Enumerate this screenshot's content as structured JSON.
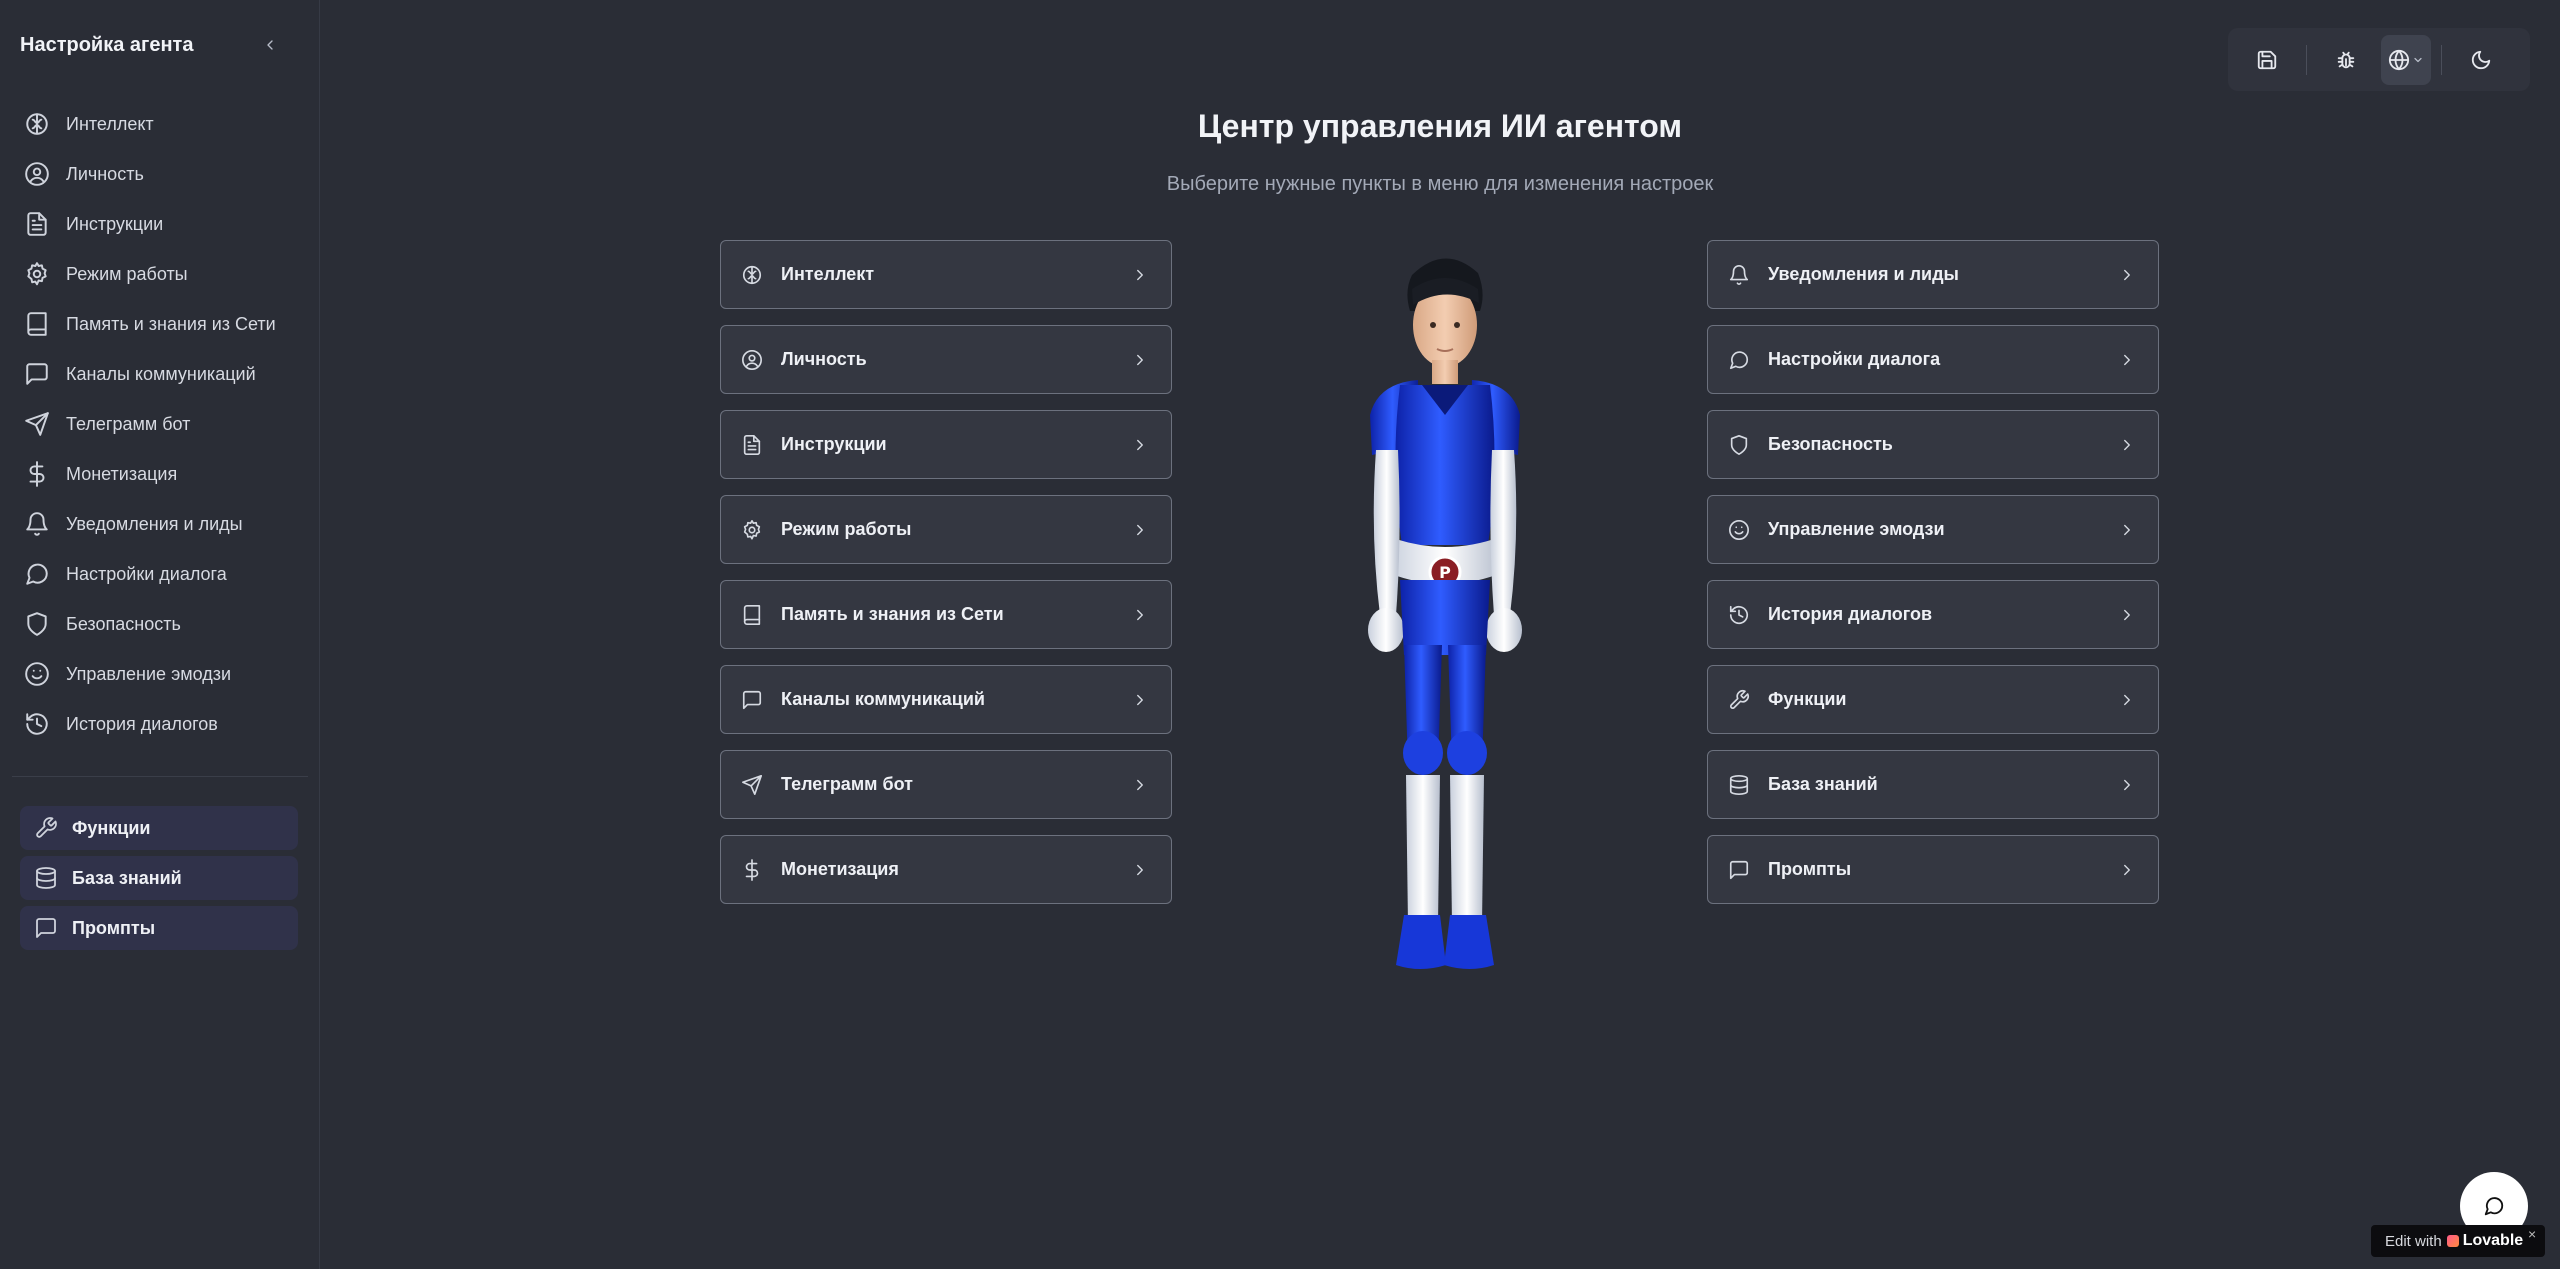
{
  "sidebar": {
    "title": "Настройка агента",
    "items": [
      {
        "label": "Интеллект",
        "icon": "brain-icon"
      },
      {
        "label": "Личность",
        "icon": "user-circle-icon"
      },
      {
        "label": "Инструкции",
        "icon": "file-text-icon"
      },
      {
        "label": "Режим работы",
        "icon": "gear-icon"
      },
      {
        "label": "Память и знания из Сети",
        "icon": "book-icon"
      },
      {
        "label": "Каналы коммуникаций",
        "icon": "message-square-icon"
      },
      {
        "label": "Телеграмм бот",
        "icon": "send-icon"
      },
      {
        "label": "Монетизация",
        "icon": "dollar-icon"
      },
      {
        "label": "Уведомления и лиды",
        "icon": "bell-icon"
      },
      {
        "label": "Настройки диалога",
        "icon": "message-circle-icon"
      },
      {
        "label": "Безопасность",
        "icon": "shield-icon"
      },
      {
        "label": "Управление эмодзи",
        "icon": "smile-icon"
      },
      {
        "label": "История диалогов",
        "icon": "history-icon"
      }
    ],
    "extra": [
      {
        "label": "Функции",
        "icon": "wrench-icon"
      },
      {
        "label": "База знаний",
        "icon": "database-icon"
      },
      {
        "label": "Промпты",
        "icon": "message-square-icon"
      }
    ]
  },
  "toolbar": {
    "buttons": [
      "save-icon",
      "bug-icon",
      "globe-icon",
      "moon-icon"
    ]
  },
  "main": {
    "title": "Центр управления ИИ агентом",
    "subtitle": "Выберите нужные пункты в меню для изменения настроек",
    "left_cards": [
      {
        "label": "Интеллект",
        "icon": "brain-icon"
      },
      {
        "label": "Личность",
        "icon": "user-circle-icon"
      },
      {
        "label": "Инструкции",
        "icon": "file-text-icon"
      },
      {
        "label": "Режим работы",
        "icon": "gear-icon"
      },
      {
        "label": "Память и знания из Сети",
        "icon": "book-icon"
      },
      {
        "label": "Каналы коммуникаций",
        "icon": "message-square-icon"
      },
      {
        "label": "Телеграмм бот",
        "icon": "send-icon"
      },
      {
        "label": "Монетизация",
        "icon": "dollar-icon"
      }
    ],
    "right_cards": [
      {
        "label": "Уведомления и лиды",
        "icon": "bell-icon"
      },
      {
        "label": "Настройки диалога",
        "icon": "message-circle-icon"
      },
      {
        "label": "Безопасность",
        "icon": "shield-icon"
      },
      {
        "label": "Управление эмодзи",
        "icon": "smile-icon"
      },
      {
        "label": "История диалогов",
        "icon": "history-icon"
      },
      {
        "label": "Функции",
        "icon": "wrench-icon"
      },
      {
        "label": "База знаний",
        "icon": "database-icon"
      },
      {
        "label": "Промпты",
        "icon": "message-square-icon"
      }
    ]
  },
  "badge": {
    "edit_with": "Edit with",
    "brand": "Lovable",
    "close": "×"
  },
  "colors": {
    "background": "#2a2d36",
    "card": "#343741",
    "card_border": "#6c717e",
    "active_item": "#30324a",
    "figure_blue": "#1737d8"
  }
}
